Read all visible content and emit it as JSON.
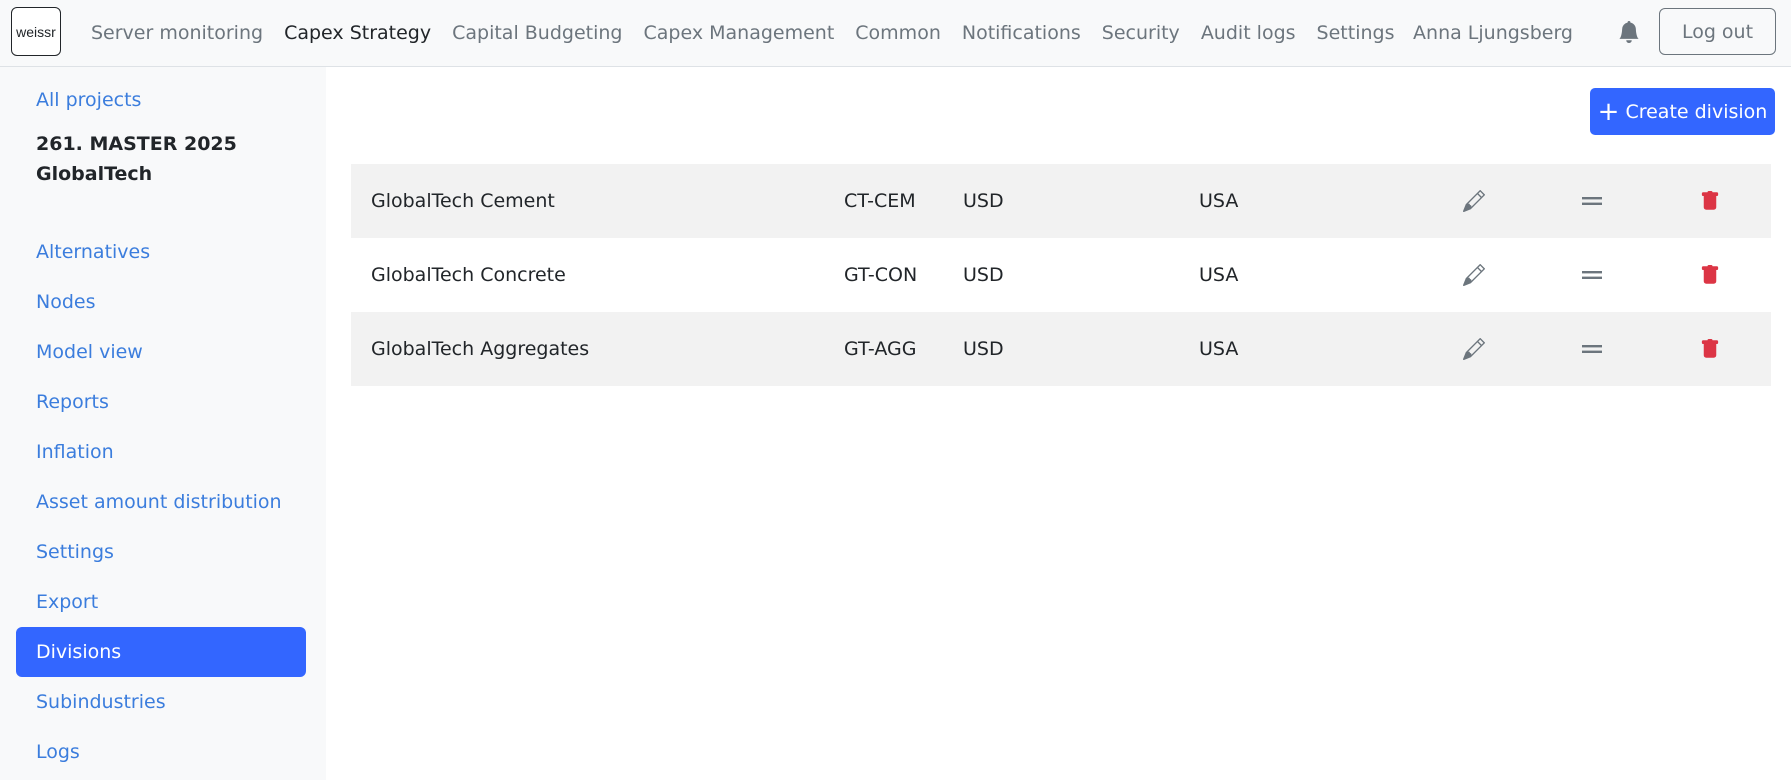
{
  "logo": {
    "text": "weissr"
  },
  "nav": {
    "items": [
      {
        "label": "Server monitoring",
        "active": false
      },
      {
        "label": "Capex Strategy",
        "active": true
      },
      {
        "label": "Capital Budgeting",
        "active": false
      },
      {
        "label": "Capex Management",
        "active": false
      },
      {
        "label": "Common",
        "active": false
      },
      {
        "label": "Notifications",
        "active": false
      },
      {
        "label": "Security",
        "active": false
      },
      {
        "label": "Audit logs",
        "active": false
      },
      {
        "label": "Settings",
        "active": false
      }
    ],
    "user_name": "Anna Ljungsberg",
    "bell_icon": "bell-icon",
    "logout_label": "Log out"
  },
  "sidebar": {
    "all_projects": "All projects",
    "project_title_line1": "261. MASTER 2025",
    "project_title_line2": "GlobalTech",
    "items": [
      {
        "label": "Alternatives"
      },
      {
        "label": "Nodes"
      },
      {
        "label": "Model view"
      },
      {
        "label": "Reports"
      },
      {
        "label": "Inflation"
      },
      {
        "label": "Asset amount distribution"
      },
      {
        "label": "Settings"
      },
      {
        "label": "Export"
      },
      {
        "label": "Divisions",
        "active": true
      },
      {
        "label": "Subindustries"
      },
      {
        "label": "Logs"
      }
    ]
  },
  "main": {
    "create_label": "Create division",
    "divisions": [
      {
        "name": "GlobalTech Cement",
        "code": "CT-CEM",
        "currency": "USD",
        "country": "USA"
      },
      {
        "name": "GlobalTech Concrete",
        "code": "GT-CON",
        "currency": "USD",
        "country": "USA"
      },
      {
        "name": "GlobalTech Aggregates",
        "code": "GT-AGG",
        "currency": "USD",
        "country": "USA"
      }
    ],
    "icons": {
      "edit": "pencil-icon",
      "drag": "drag-handle-icon",
      "delete": "trash-icon"
    }
  },
  "colors": {
    "primary": "#3366ff",
    "link": "#3b7ddd",
    "danger": "#dc3545",
    "muted": "#6c757d",
    "stripe": "#f2f2f2"
  }
}
